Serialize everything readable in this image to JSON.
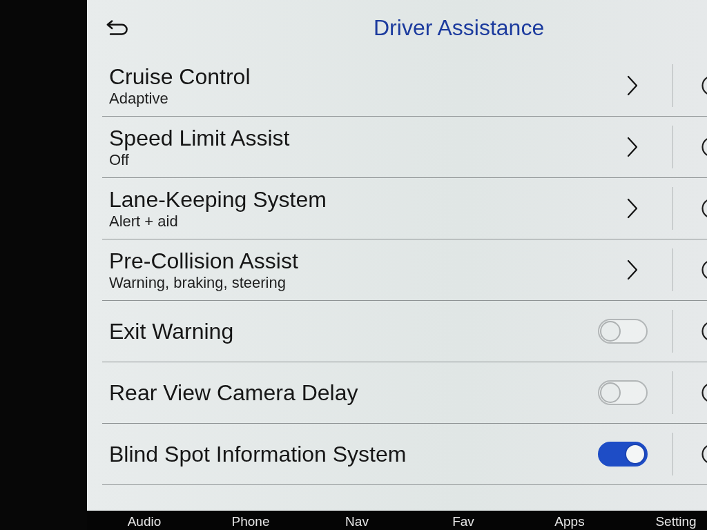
{
  "header": {
    "title": "Driver Assistance"
  },
  "settings": [
    {
      "kind": "submenu",
      "label": "Cruise Control",
      "value": "Adaptive"
    },
    {
      "kind": "submenu",
      "label": "Speed Limit Assist",
      "value": "Off"
    },
    {
      "kind": "submenu",
      "label": "Lane-Keeping System",
      "value": "Alert + aid"
    },
    {
      "kind": "submenu",
      "label": "Pre-Collision Assist",
      "value": "Warning, braking, steering"
    },
    {
      "kind": "toggle",
      "label": "Exit Warning",
      "on": false
    },
    {
      "kind": "toggle",
      "label": "Rear View Camera Delay",
      "on": false
    },
    {
      "kind": "toggle",
      "label": "Blind Spot Information System",
      "on": true
    }
  ],
  "bottom_nav": [
    "Audio",
    "Phone",
    "Nav",
    "Fav",
    "Apps",
    "Setting"
  ]
}
